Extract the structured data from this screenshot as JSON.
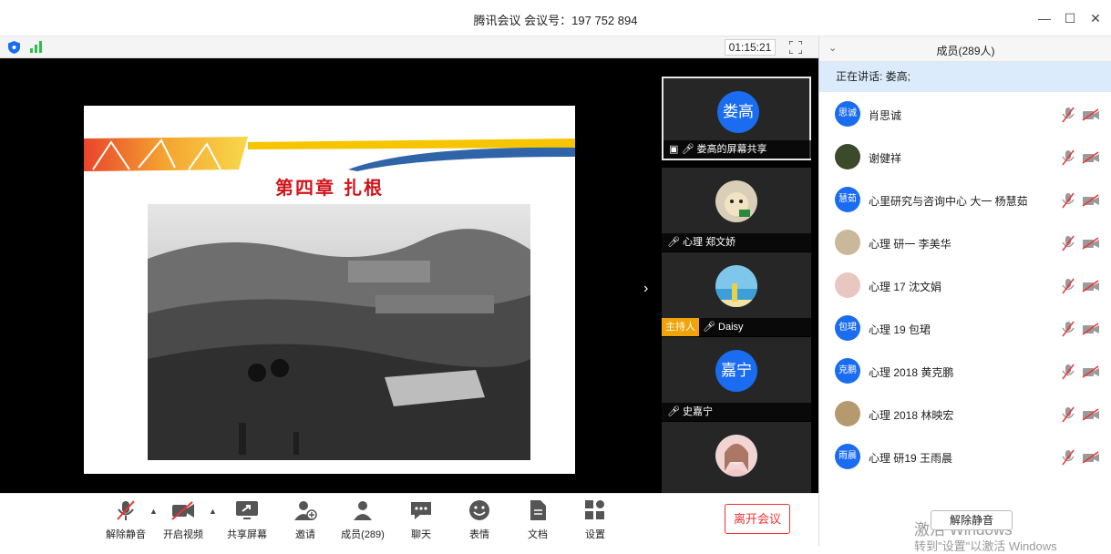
{
  "window": {
    "title": "腾讯会议 会议号：197 752 894"
  },
  "status": {
    "timer": "01:15:21"
  },
  "slide": {
    "title": "第四章 扎根"
  },
  "thumbs": [
    {
      "avatar_text": "娄高",
      "label": "娄高的屏幕共享",
      "active": true
    },
    {
      "avatar_text": "",
      "label": "心理  郑文娇"
    },
    {
      "avatar_text": "",
      "host_tag": "主持人",
      "label": "Daisy"
    },
    {
      "avatar_text": "嘉宁",
      "label": "史嘉宁"
    },
    {
      "avatar_text": "",
      "label": ""
    }
  ],
  "toolbar": {
    "unmute": "解除静音",
    "video": "开启视频",
    "share": "共享屏幕",
    "invite": "邀请",
    "members": "成员(289)",
    "chat": "聊天",
    "emoji": "表情",
    "docs": "文档",
    "settings": "设置",
    "leave": "离开会议"
  },
  "panel": {
    "title": "成员(289人)",
    "speaking": "正在讲话: 娄高;",
    "members": [
      {
        "avatar_text": "思诚",
        "name": "肖思诚"
      },
      {
        "avatar_text": "",
        "name": "谢健祥"
      },
      {
        "avatar_text": "慧茹",
        "name": "心里研究与咨询中心 大一 杨慧茹"
      },
      {
        "avatar_text": "",
        "name": "心理  研一  李美华"
      },
      {
        "avatar_text": "",
        "name": "心理 17 沈文娟"
      },
      {
        "avatar_text": "包珺",
        "name": "心理 19  包珺"
      },
      {
        "avatar_text": "克鹏",
        "name": "心理 2018 黄克鹏"
      },
      {
        "avatar_text": "",
        "name": "心理 2018 林映宏"
      },
      {
        "avatar_text": "雨晨",
        "name": "心理 研19 王雨晨"
      }
    ],
    "unmute_all": "解除静音",
    "watermark_line1": "激活 Windows",
    "watermark_line2": "转到\"设置\"以激活 Windows"
  },
  "colors": {
    "accent": "#1a6cf0",
    "leave": "#e33333",
    "host": "#f0a30a"
  }
}
